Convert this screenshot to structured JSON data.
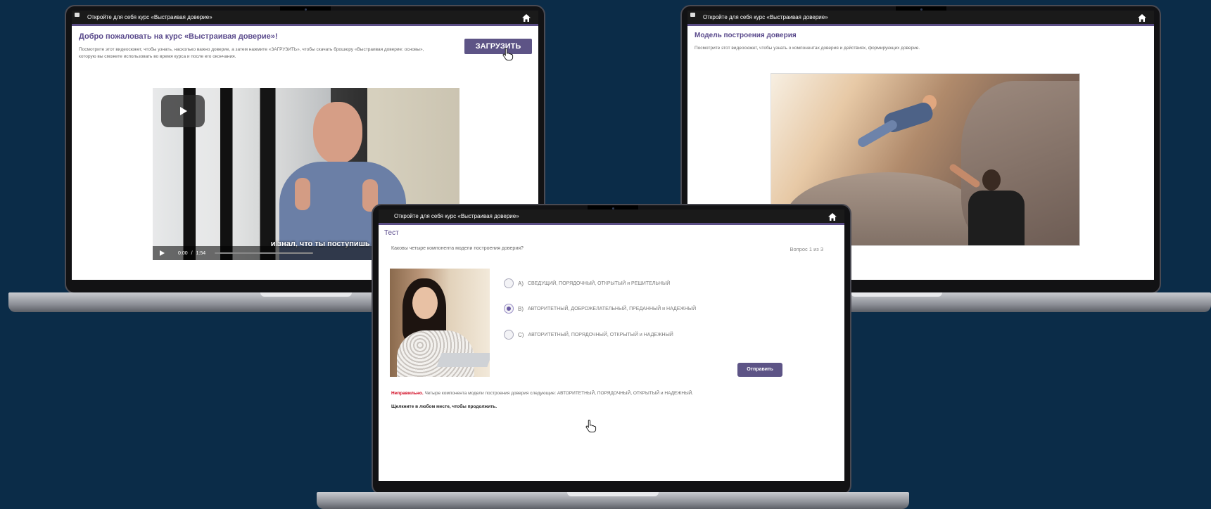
{
  "course_title": "Откройте для себя курс «Выстраивая доверие»",
  "left_screen": {
    "heading": "Добро пожаловать на курс «Выстраивая доверие»!",
    "description": "Посмотрите этот видеосюжет, чтобы узнать, насколько важно доверие, а затем нажмите «ЗАГРУЗИТЬ», чтобы скачать брошюру «Выстраивая доверие: основы», которую вы сможете использовать во время курса и после его окончания.",
    "download_label": "ЗАГРУЗИТЬ",
    "video": {
      "time_current": "0:00",
      "time_separator": "/",
      "time_total": "1:54",
      "subtitle": "и знал, что ты поступишь так, как нужно»."
    }
  },
  "right_screen": {
    "heading": "Модель построения доверия",
    "description": "Посмотрите этот видеосюжет, чтобы узнать о компонентах доверия и действиях, формирующих доверие."
  },
  "center_screen": {
    "section": "Тест",
    "question": "Каковы четыре компонента модели построения доверия?",
    "counter": "Вопрос 1 из 3",
    "options": [
      {
        "letter": "A)",
        "text": "СВЕДУЩИЙ, ПОРЯДОЧНЫЙ, ОТКРЫТЫЙ и РЕШИТЕЛЬНЫЙ",
        "selected": false
      },
      {
        "letter": "B)",
        "text": "АВТОРИТЕТНЫЙ, ДОБРОЖЕЛАТЕЛЬНЫЙ, ПРЕДАННЫЙ и НАДЕЖНЫЙ",
        "selected": true
      },
      {
        "letter": "C)",
        "text": "АВТОРИТЕТНЫЙ, ПОРЯДОЧНЫЙ, ОТКРЫТЫЙ и НАДЕЖНЫЙ",
        "selected": false
      }
    ],
    "submit_label": "Отправить",
    "feedback_label": "Неправильно.",
    "feedback_text": "Четыре компонента модели построения доверия следующие: АВТОРИТЕТНЫЙ, ПОРЯДОЧНЫЙ, ОТКРЫТЫЙ и НАДЕЖНЫЙ.",
    "continue_text": "Щелкните в любом месте, чтобы продолжить."
  },
  "colors": {
    "background": "#0b2c48",
    "accent": "#5d5486",
    "heading": "#5a4a8c",
    "error": "#d0021b"
  },
  "icons": [
    "home-icon",
    "play-icon",
    "hand-cursor-icon",
    "window-corner-icon"
  ]
}
